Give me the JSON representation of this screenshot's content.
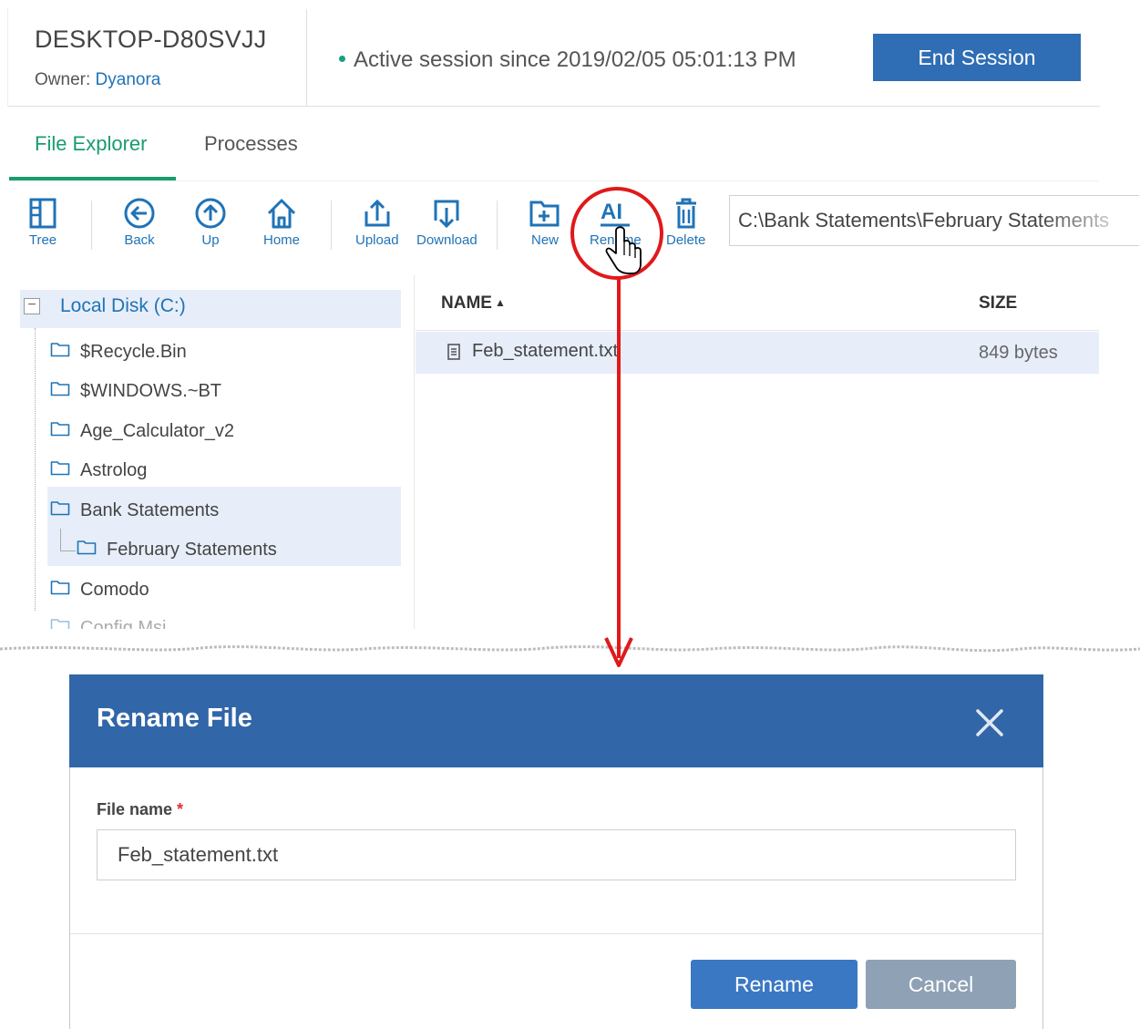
{
  "session": {
    "device": "DESKTOP-D80SVJJ",
    "owner_label": "Owner:",
    "owner_name": "Dyanora",
    "status": "Active session since 2019/02/05 05:01:13 PM",
    "end_button": "End Session"
  },
  "tabs": [
    {
      "label": "File Explorer",
      "active": true
    },
    {
      "label": "Processes",
      "active": false
    }
  ],
  "toolbar": {
    "tree": "Tree",
    "back": "Back",
    "up": "Up",
    "home": "Home",
    "upload": "Upload",
    "download": "Download",
    "new": "New",
    "rename": "Rename",
    "delete": "Delete",
    "path": "C:\\Bank Statements\\February Statements"
  },
  "tree": {
    "root": "Local Disk (C:)",
    "items": [
      "$Recycle.Bin",
      "$WINDOWS.~BT",
      "Age_Calculator_v2",
      "Astrolog",
      "Bank Statements",
      "February Statements",
      "Comodo",
      "Config.Msi"
    ]
  },
  "grid": {
    "col_name": "NAME",
    "col_size": "SIZE",
    "rows": [
      {
        "name": "Feb_statement.txt",
        "size": "849 bytes"
      }
    ]
  },
  "dialog": {
    "title": "Rename File",
    "field_label": "File name",
    "required_mark": "*",
    "value": "Feb_statement.txt",
    "rename_button": "Rename",
    "cancel_button": "Cancel"
  },
  "colors": {
    "accent_green": "#1a9c6d",
    "link_blue": "#1f73b7",
    "header_blue": "#3166a8",
    "annotation_red": "#e0191b"
  }
}
